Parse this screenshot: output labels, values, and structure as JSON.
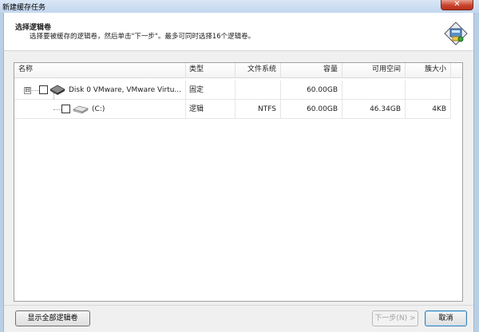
{
  "window": {
    "title": "新建缓存任务",
    "close_glyph": "✕"
  },
  "header": {
    "title": "选择逻辑卷",
    "description": "选择要被缓存的逻辑卷，然后单击\"下一步\"。最多可同时选择16个逻辑卷。"
  },
  "list": {
    "columns": [
      "名称",
      "类型",
      "文件系统",
      "容量",
      "可用空间",
      "簇大小"
    ],
    "rows": [
      {
        "expander": "⊟",
        "name": "Disk 0 VMware, VMware Virtu...",
        "type": "固定",
        "filesystem": "",
        "capacity": "60.00GB",
        "free": "",
        "cluster": "",
        "icon": "hard-disk-icon"
      },
      {
        "name": "(C:)",
        "type": "逻辑",
        "filesystem": "NTFS",
        "capacity": "60.00GB",
        "free": "46.34GB",
        "cluster": "4KB",
        "icon": "volume-icon"
      }
    ]
  },
  "buttons": {
    "show_all": "显示全部逻辑卷",
    "next": "下一步(N) >",
    "cancel": "取消"
  },
  "colors": {
    "titlebar": "#c3d7ee",
    "dialog_bg": "#f0f0f0",
    "close_button": "#c9442f",
    "default_button_border": "#3c7fb1"
  }
}
